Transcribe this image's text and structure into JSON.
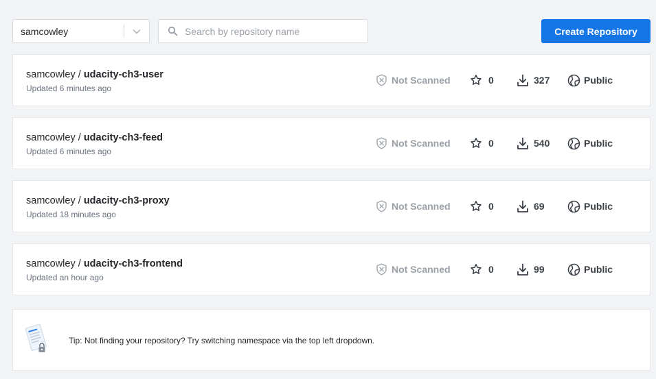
{
  "namespace": {
    "selected": "samcowley"
  },
  "search": {
    "placeholder": "Search by repository name",
    "value": ""
  },
  "create_button": {
    "label": "Create Repository"
  },
  "repositories": [
    {
      "owner": "samcowley",
      "separator": " / ",
      "name": "udacity-ch3-user",
      "updated": "Updated 6 minutes ago",
      "scan_status": "Not Scanned",
      "stars": "0",
      "pulls": "327",
      "visibility": "Public"
    },
    {
      "owner": "samcowley",
      "separator": " / ",
      "name": "udacity-ch3-feed",
      "updated": "Updated 6 minutes ago",
      "scan_status": "Not Scanned",
      "stars": "0",
      "pulls": "540",
      "visibility": "Public"
    },
    {
      "owner": "samcowley",
      "separator": " / ",
      "name": "udacity-ch3-proxy",
      "updated": "Updated 18 minutes ago",
      "scan_status": "Not Scanned",
      "stars": "0",
      "pulls": "69",
      "visibility": "Public"
    },
    {
      "owner": "samcowley",
      "separator": " / ",
      "name": "udacity-ch3-frontend",
      "updated": "Updated an hour ago",
      "scan_status": "Not Scanned",
      "stars": "0",
      "pulls": "99",
      "visibility": "Public"
    }
  ],
  "tip": {
    "text": "Tip: Not finding your repository? Try switching namespace via the top left dropdown."
  },
  "colors": {
    "primary": "#1475e6",
    "background": "#f2f3f5",
    "muted": "#9aa0a8",
    "text": "#25272b"
  },
  "icons": {
    "namespace_dropdown": "chevron-down-icon",
    "search": "search-icon",
    "scan": "shield-x-icon",
    "stars": "star-icon",
    "pulls": "download-icon",
    "visibility": "globe-icon",
    "tip": "document-lock-illustration"
  }
}
